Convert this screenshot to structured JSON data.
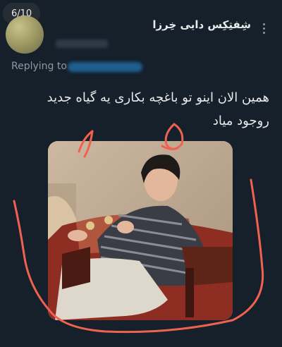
{
  "counter": "6/10",
  "tweet": {
    "display_name": "شِفتِکِس دایی خِرزا",
    "replying_label": "Replying to",
    "text_line1": "همین الان اینو تو باغچه بکاری یه گیاه جدید",
    "text_line2": "روجود میاد"
  },
  "colors": {
    "background": "#15202b",
    "text": "#e7e9ea",
    "secondary": "#8b98a5",
    "annotation": "#f0614f"
  },
  "icons": {
    "more": "more-vertical-icon"
  }
}
